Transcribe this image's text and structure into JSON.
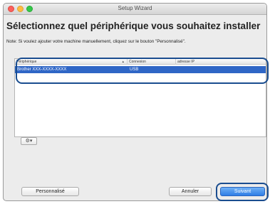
{
  "window": {
    "title": "Setup Wizard"
  },
  "heading": "Sélectionnez quel périphérique vous souhaitez installer",
  "note": "Note: Si voulez ajouter votre machine manuellement, cliquez sur le bouton \"Personnalisé\".",
  "table": {
    "columns": [
      "Périphérique",
      "Connexion",
      "adresse IP"
    ],
    "rows": [
      {
        "device": "Brother  XXX-XXXX-XXXX",
        "connection": "USB",
        "ip": "",
        "selected": true
      }
    ]
  },
  "gear_menu": {
    "icon": "gear-icon",
    "caret": "▾"
  },
  "buttons": {
    "custom": "Personnalisé",
    "cancel": "Annuler",
    "next": "Suivant"
  },
  "colors": {
    "selection": "#2f66c6",
    "default_button": "#2f7ee6",
    "callout": "#1a4d8f"
  }
}
